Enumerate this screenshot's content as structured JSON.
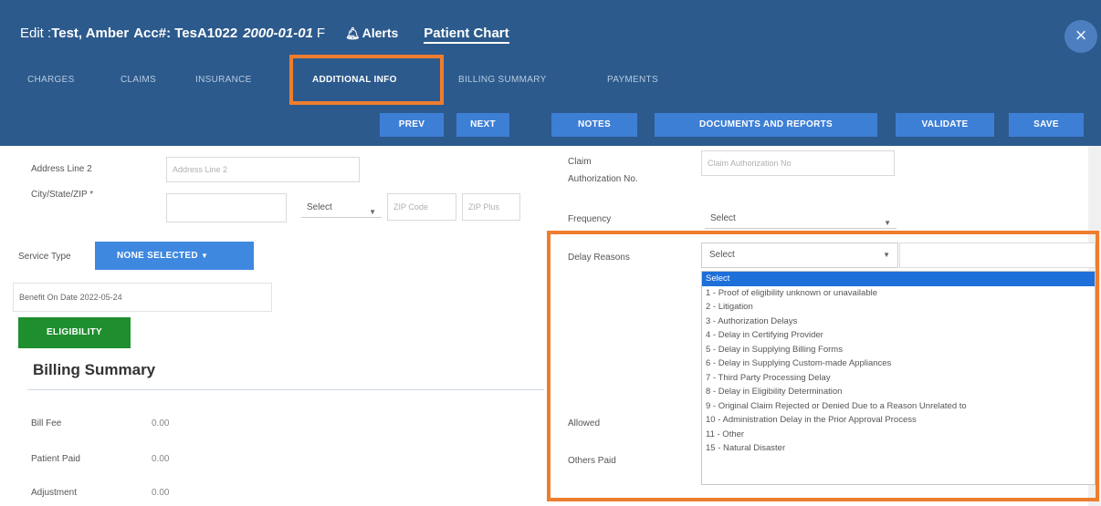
{
  "header": {
    "edit_prefix": "Edit : ",
    "patient_name": "Test, Amber",
    "acc_label": "Acc#: TesA1022",
    "dob": "2000-01-01",
    "sex": "F",
    "alerts": "Alerts",
    "patient_chart": "Patient Chart",
    "close": "×"
  },
  "tabs": [
    {
      "label": "CHARGES"
    },
    {
      "label": "CLAIMS"
    },
    {
      "label": "INSURANCE"
    },
    {
      "label": "ADDITIONAL INFO"
    },
    {
      "label": "BILLING SUMMARY"
    },
    {
      "label": "PAYMENTS"
    }
  ],
  "toolbar": {
    "prev": "PREV",
    "next": "NEXT",
    "notes": "NOTES",
    "documents": "DOCUMENTS AND REPORTS",
    "validate": "VALIDATE",
    "save": "SAVE"
  },
  "form": {
    "address2_label": "Address Line 2",
    "address2_placeholder": "Address Line 2",
    "city_label": "City/State/ZIP *",
    "state_select": "Select",
    "zip_code_placeholder": "ZIP Code",
    "zip_plus_placeholder": "ZIP Plus",
    "claim_auth_label_1": "Claim",
    "claim_auth_label_2": "Authorization No.",
    "claim_auth_placeholder": "Claim Authorization No",
    "frequency_label": "Frequency",
    "frequency_value": "Select",
    "delay_reasons_label": "Delay Reasons",
    "delay_reasons_value": "Select",
    "service_type_label": "Service Type",
    "service_type_button": "NONE SELECTED",
    "benefit_label": "Benefit On Date",
    "benefit_value": "2022-05-24",
    "eligibility_button": "ELIGIBILITY"
  },
  "billing_summary": {
    "title": "Billing Summary",
    "rows": [
      {
        "label": "Bill Fee",
        "value": "0.00"
      },
      {
        "label": "Patient Paid",
        "value": "0.00"
      },
      {
        "label": "Adjustment",
        "value": "0.00"
      }
    ],
    "right_labels": [
      "Allowed",
      "Others Paid"
    ]
  },
  "delay_reasons_options": [
    "Select",
    "1 - Proof of eligibility unknown or unavailable",
    "2 - Litigation",
    "3 - Authorization Delays",
    "4 - Delay in Certifying Provider",
    "5 - Delay in Supplying Billing Forms",
    "6 - Delay in Supplying Custom-made Appliances",
    "7 - Third Party Processing Delay",
    "8 - Delay in Eligibility Determination",
    "9 - Original Claim Rejected or Denied Due to a Reason Unrelated to",
    "10 - Administration Delay in the Prior Approval Process",
    "11 - Other",
    "15 - Natural Disaster"
  ],
  "colors": {
    "header": "#2c5a8c",
    "primary_button": "#3e7fd6",
    "eligibility": "#1f8e2f",
    "highlight": "#ee7d2e",
    "selected_option": "#1e6fd9"
  }
}
